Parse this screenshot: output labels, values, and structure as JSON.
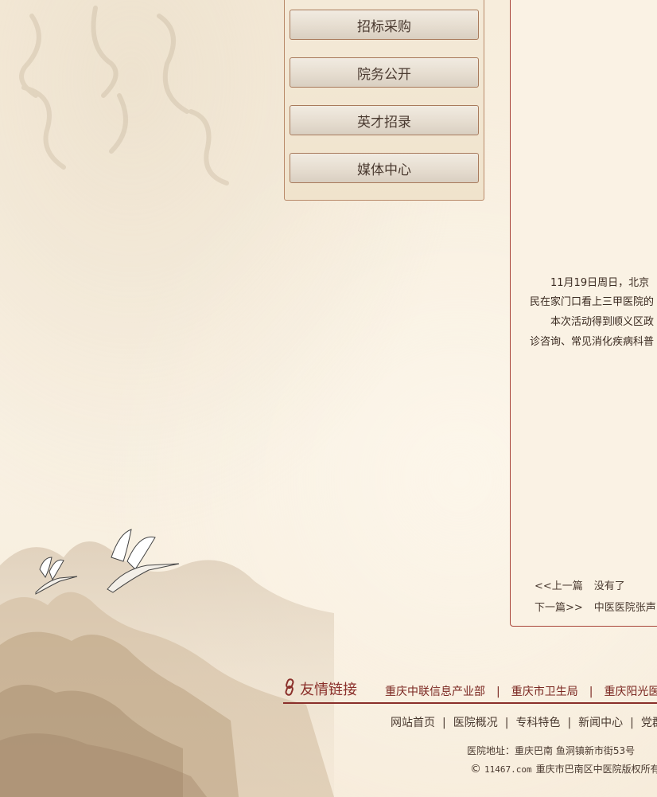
{
  "menu": {
    "items": [
      {
        "label": "招标采购"
      },
      {
        "label": "院务公开"
      },
      {
        "label": "英才招录"
      },
      {
        "label": "媒体中心"
      }
    ]
  },
  "article": {
    "paragraphs": [
      "　　11月19日周日，北京",
      "民在家门口看上三甲医院的",
      "　　本次活动得到顺义区政",
      "诊咨询、常见消化疾病科普"
    ],
    "prev_label": "<<上一篇",
    "prev_title": "没有了",
    "next_label": "下一篇>>",
    "next_title": "中医医院张声"
  },
  "friends": {
    "title": "友情链接",
    "links": [
      "重庆中联信息产业部",
      "重庆市卫生局",
      "重庆阳光医"
    ]
  },
  "footer": {
    "nav": [
      "网站首页",
      "医院概况",
      "专科特色",
      "新闻中心",
      "党群"
    ],
    "address": "医院地址：重庆巴南 鱼洞镇新市街53号",
    "copyright_mark": "©",
    "domain": "11467.com",
    "copyright_text": "重庆市巴南区中医院版权所有"
  },
  "colors": {
    "accent": "#8a2f2a",
    "panel_border": "#a8453a",
    "background": "#f8efdf"
  },
  "icons": [
    "link-chain-icon",
    "crane-illustration",
    "mountain-landscape"
  ]
}
